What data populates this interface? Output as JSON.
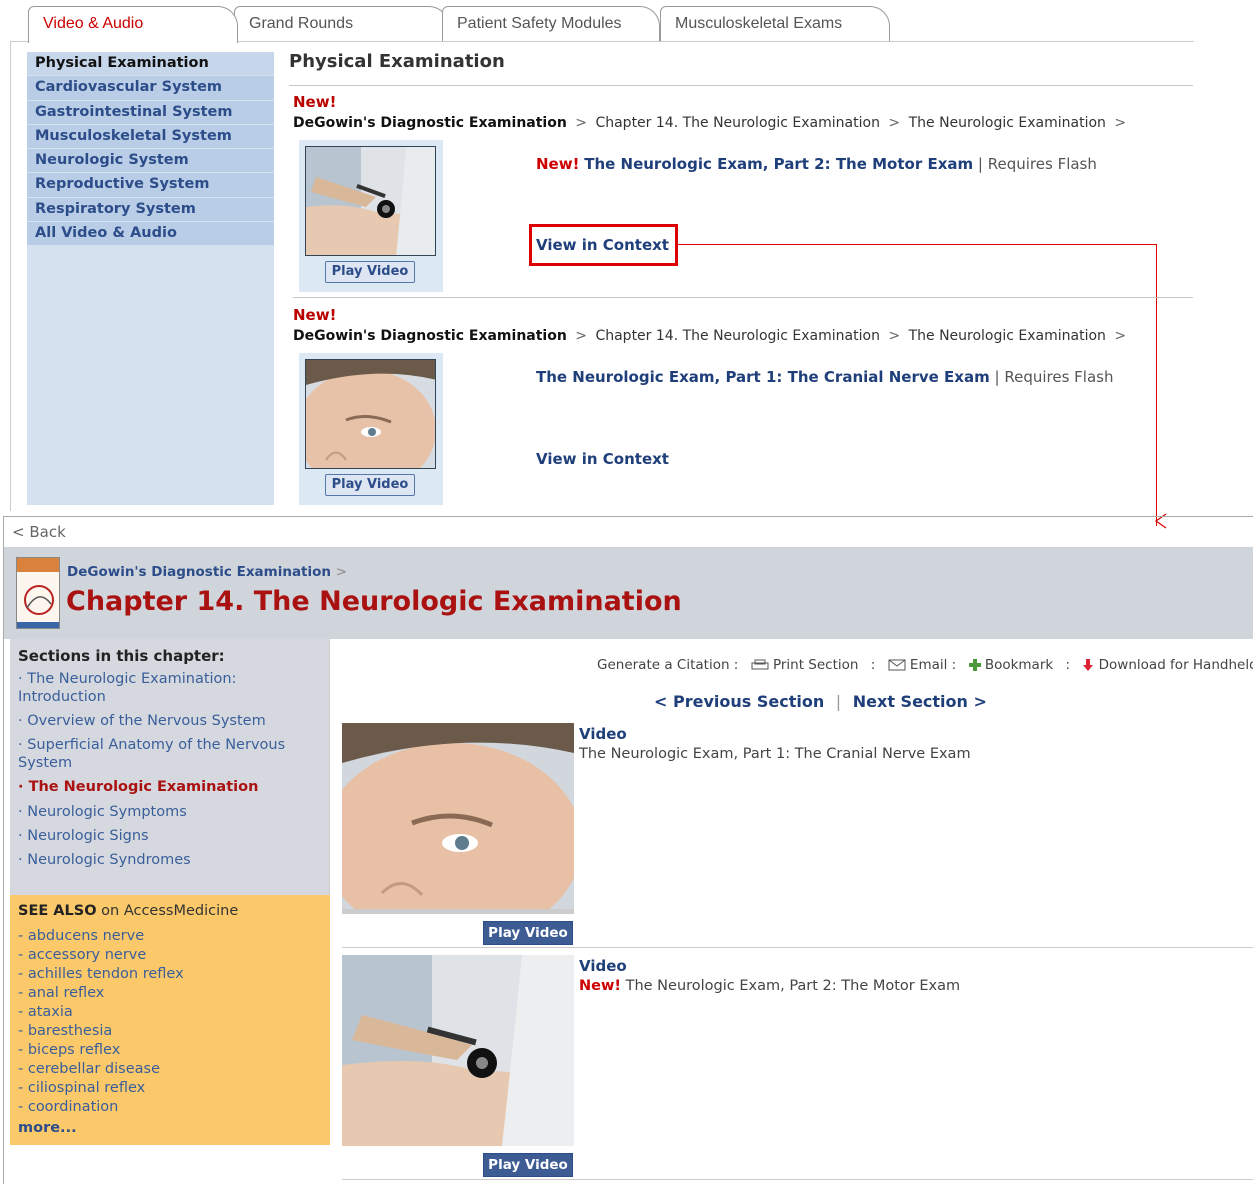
{
  "tabs": [
    "Video & Audio",
    "Grand Rounds",
    "Patient Safety Modules",
    "Musculoskeletal Exams"
  ],
  "leftnav": [
    "Physical Examination",
    "Cardiovascular System",
    "Gastrointestinal System",
    "Musculoskeletal System",
    "Neurologic System",
    "Reproductive System",
    "Respiratory System",
    "All Video & Audio"
  ],
  "main": {
    "title": "Physical Examination",
    "entries": [
      {
        "new_label": "New!",
        "crumb_book": "DeGowin's Diagnostic Examination",
        "crumb_sep": ">",
        "crumb_chapter": "Chapter 14. The Neurologic Examination",
        "crumb_section": "The Neurologic Examination",
        "new_prefix": "New!",
        "video_title": "The Neurologic Exam, Part 2: The Motor Exam",
        "requires": "| Requires Flash",
        "view": "View in Context",
        "play": "Play Video"
      },
      {
        "new_label": "New!",
        "crumb_book": "DeGowin's Diagnostic Examination",
        "crumb_sep": ">",
        "crumb_chapter": "Chapter 14. The Neurologic Examination",
        "crumb_section": "The Neurologic Examination",
        "video_title": "The Neurologic Exam, Part 1: The Cranial Nerve Exam",
        "requires": "| Requires Flash",
        "view": "View in Context",
        "play": "Play Video"
      }
    ]
  },
  "bottom": {
    "back": "< Back",
    "crumb_book": "DeGowin's Diagnostic Examination",
    "crumb_sep": ">",
    "chapter_title": "Chapter 14. The Neurologic Examination",
    "sections_heading": "Sections in this chapter:",
    "sections": [
      "The Neurologic Examination: Introduction",
      "Overview of the Nervous System",
      "Superficial Anatomy of the Nervous System",
      "The Neurologic Examination",
      "Neurologic Symptoms",
      "Neurologic Signs",
      "Neurologic Syndromes"
    ],
    "see_also_bold": "SEE ALSO",
    "see_also_rest": "on AccessMedicine",
    "see_also_items": [
      "- abducens nerve",
      "- accessory nerve",
      "- achilles tendon reflex",
      "- anal reflex",
      "- ataxia",
      "- baresthesia",
      "- biceps reflex",
      "- cerebellar disease",
      "- ciliospinal reflex",
      "- coordination"
    ],
    "more": "more...",
    "toolbar": {
      "citation": "Generate a Citation :",
      "print": "Print Section",
      "sep": ":",
      "email": "Email :",
      "bookmark": "Bookmark",
      "download": "Download for Handheld"
    },
    "prev": "< Previous Section",
    "bar": "|",
    "next": "Next Section >",
    "media": [
      {
        "label": "Video",
        "desc": "The Neurologic Exam, Part 1: The Cranial Nerve Exam",
        "play": "Play Video"
      },
      {
        "label": "Video",
        "new": "New!",
        "desc": "The Neurologic Exam, Part 2: The Motor Exam",
        "play": "Play Video"
      }
    ]
  },
  "colors": {
    "accent_red": "#cc0000",
    "link_blue": "#1f3f7a",
    "nav_bg": "#b9cde6",
    "see_also_bg": "#fbc96a"
  }
}
